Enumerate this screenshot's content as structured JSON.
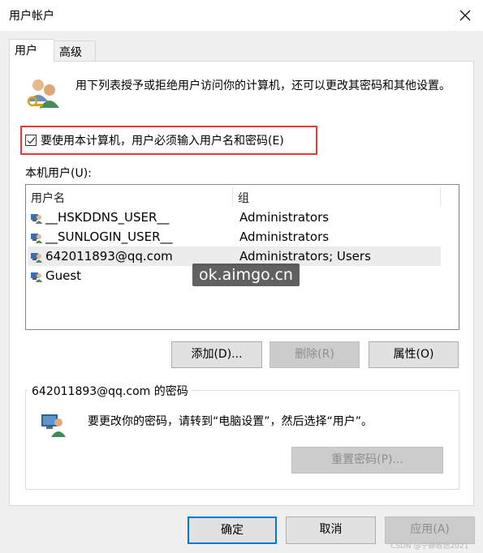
{
  "window": {
    "title": "用户帐户",
    "close_icon": "close-icon"
  },
  "tabs": [
    {
      "label": "用户",
      "active": true
    },
    {
      "label": "高级",
      "active": false
    }
  ],
  "intro": {
    "icon": "users-key-icon",
    "text": "用下列表授予或拒绝用户访问你的计算机，还可以更改其密码和其他设置。"
  },
  "require_password": {
    "checked": true,
    "label": "要使用本计算机，用户必须输入用户名和密码(E)"
  },
  "local_users": {
    "label": "本机用户(U):",
    "columns": [
      "用户名",
      "组"
    ],
    "rows": [
      {
        "name": "__HSKDDNS_USER__",
        "group": "Administrators",
        "selected": false
      },
      {
        "name": "__SUNLOGIN_USER__",
        "group": "Administrators",
        "selected": false
      },
      {
        "name": "642011893@qq.com",
        "group": "Administrators; Users",
        "selected": true
      },
      {
        "name": "Guest",
        "group": "",
        "selected": false
      }
    ]
  },
  "watermark": "ok.aimgo.cn",
  "buttons": {
    "add": "添加(D)...",
    "delete": "删除(R)",
    "properties": "属性(O)"
  },
  "password_group": {
    "title": "642011893@qq.com 的密码",
    "text": "要更改你的密码，请转到“电脑设置”，然后选择“用户”。",
    "reset_button": "重置密码(P)..."
  },
  "dialog_buttons": {
    "ok": "确定",
    "cancel": "取消",
    "apply": "应用(A)"
  },
  "footer_watermark": "CSDN @宁静致远2021",
  "colors": {
    "highlight_border": "#e53935",
    "default_button_border": "#0078d7"
  }
}
